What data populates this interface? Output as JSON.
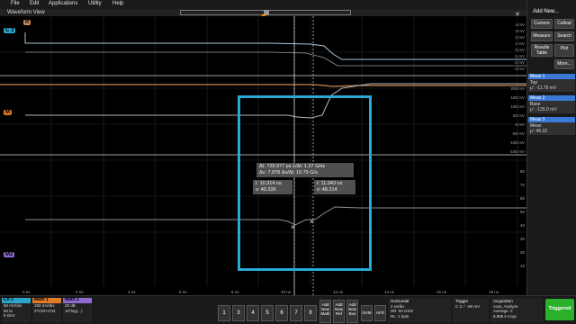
{
  "menu": {
    "items": [
      "File",
      "Edit",
      "Applications",
      "Utility",
      "Help"
    ]
  },
  "waveform_view": {
    "title": "Waveform View",
    "close_glyph": "✕"
  },
  "channel_labels": {
    "c3": "C 3",
    "ref": "R",
    "math1": "M",
    "math2": "M2",
    "top_marker": "C"
  },
  "cursor_tags": {
    "a": "M2",
    "b1": "A",
    "b2": "B",
    "m": "M2"
  },
  "readout_delta": {
    "line1": "Δt: 729.977 ps    1/Δt: 1.37 GHz",
    "line2": "Δv: 7.878    Δv/Δt: 10.79 G/s"
  },
  "readout_a": {
    "t": "t: 10.314 ns",
    "v": "v: 40.336"
  },
  "readout_b": {
    "t": "t: 11.043 ns",
    "v": "v: 48.214"
  },
  "volt_ticks_ch3": [
    "4 mV",
    "3 mV",
    "2 mV",
    "1 mV",
    "0 mV",
    "-1 mV",
    "-2 mV",
    "-3 mV",
    "-4 mV"
  ],
  "volt_ticks_math": [
    "200 mV",
    "150 mV",
    "100 mV",
    "50 mV",
    "0 mV",
    "-50 mV",
    "-100 mV",
    "-150 mV",
    "-200 mV"
  ],
  "volt_ticks_math2": [
    "80",
    "70",
    "60",
    "50",
    "40",
    "30",
    "20",
    "10"
  ],
  "time_ticks": [
    "0 ns",
    "2 ns",
    "4 ns",
    "6 ns",
    "8 ns",
    "10 ns",
    "12 ns",
    "14 ns",
    "16 ns",
    "18 ns"
  ],
  "side": {
    "title": "Add New...",
    "buttons": [
      "Cursors",
      "Callout",
      "Measure",
      "Search",
      "Results Table",
      "Plot",
      "More..."
    ]
  },
  "measurements": [
    {
      "header": "Meas 1",
      "label": "Top",
      "value": "μ': -11.78 mV",
      "color": "#3a7ad6"
    },
    {
      "header": "Meas 2",
      "label": "Base",
      "value": "μ': -135.0 mV",
      "color": "#3a7ad6"
    },
    {
      "header": "Meas 3",
      "label": "Mean",
      "value": "μ': 46.02",
      "color": "#3a7ad6"
    }
  ],
  "status": {
    "ch3": {
      "hd": "Ch 3",
      "lines": [
        "50 mV/div",
        "50 Ω",
        "9 GHz"
      ]
    },
    "math1": {
      "hd": "Math 1",
      "lines": [
        "250 mV/div",
        "2*Ch2+Ch3"
      ]
    },
    "math2": {
      "hd": "Math 2",
      "lines": [
        "20 dB",
        "10*log(...)"
      ]
    },
    "numbers": [
      "1",
      "3",
      "4",
      "5",
      "6",
      "7",
      "8"
    ],
    "add": [
      {
        "label": "Add New Math"
      },
      {
        "label": "Add New Ref"
      },
      {
        "label": "Add New Bus"
      }
    ],
    "small": [
      "DVM",
      "AFG"
    ],
    "horizontal": {
      "title": "Horizontal",
      "lines": [
        "2 ns/div",
        "SR: 50 GS/s",
        "RL: 1 kpts"
      ],
      "lines2": [
        "20 ns",
        "20 ps/pt",
        "⊕ 8.15 ns"
      ]
    },
    "trigger": {
      "title": "Trigger",
      "lines": [
        "C 3  ⟋  -80 mV"
      ]
    },
    "acq": {
      "title": "Acquisition",
      "lines": [
        "Auto,   Analyze",
        "Average: 2",
        "8.888 k Acqs"
      ]
    },
    "date": {
      "lines": [
        "31 Sep 2021",
        "11:22:44 PM"
      ]
    },
    "triggered": "Triggered"
  },
  "colors": {
    "ch3": "#2aa6c9",
    "math1": "#e07b2a",
    "math2": "#8f6bd1",
    "ref": "#c98a5a",
    "zoom": "#29a9d6",
    "triggered": "#2bb02b"
  }
}
